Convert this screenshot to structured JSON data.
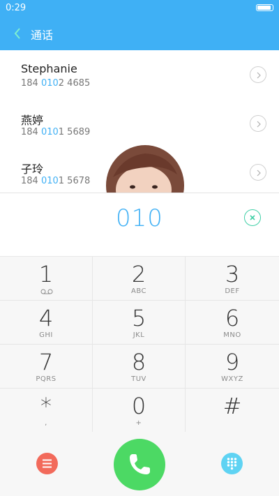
{
  "status_bar": {
    "time": "0:29",
    "battery_level": 1.0
  },
  "header": {
    "title": "通话",
    "back_icon": "chevron-left-icon"
  },
  "contacts": [
    {
      "name": "Stephanie",
      "number_prefix": "184 ",
      "number_match": "010",
      "number_suffix": "2 4685"
    },
    {
      "name": "燕婷",
      "number_prefix": "184 ",
      "number_match": "010",
      "number_suffix": "1 5689"
    },
    {
      "name": "子玲",
      "number_prefix": "184 ",
      "number_match": "010",
      "number_suffix": "1 5678"
    }
  ],
  "entry": {
    "number": "010",
    "clear_icon": "clear-icon"
  },
  "keys": [
    {
      "digit": "1",
      "letters": ""
    },
    {
      "digit": "2",
      "letters": "ABC"
    },
    {
      "digit": "3",
      "letters": "DEF"
    },
    {
      "digit": "4",
      "letters": "GHI"
    },
    {
      "digit": "5",
      "letters": "JKL"
    },
    {
      "digit": "6",
      "letters": "MNO"
    },
    {
      "digit": "7",
      "letters": "PQRS"
    },
    {
      "digit": "8",
      "letters": "TUV"
    },
    {
      "digit": "9",
      "letters": "WXYZ"
    },
    {
      "digit": "*",
      "letters": ","
    },
    {
      "digit": "0",
      "letters": "+"
    },
    {
      "digit": "#",
      "letters": ""
    }
  ],
  "bottom_bar": {
    "menu_icon": "menu-icon",
    "call_icon": "phone-icon",
    "dialpad_icon": "dialpad-icon"
  },
  "colors": {
    "accent": "#3fb0f5",
    "call": "#4cd964",
    "menu": "#f26a5b",
    "dialpad": "#5fd3f3",
    "clear": "#3fcfa6"
  }
}
